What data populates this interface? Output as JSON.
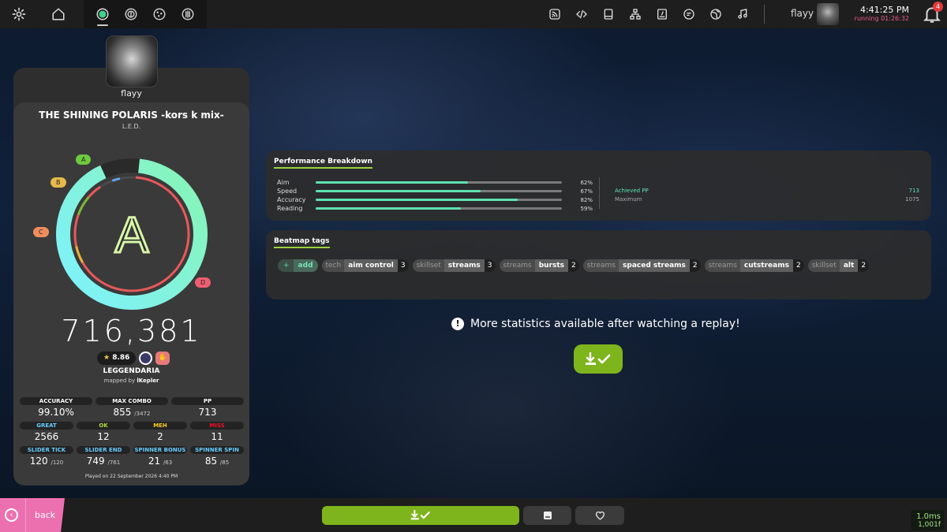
{
  "topbar": {
    "left_icons": [
      "gear-icon",
      "home-icon"
    ],
    "mode_icons": [
      "osu-mode-icon",
      "taiko-mode-icon",
      "catch-mode-icon",
      "mania-mode-icon"
    ],
    "active_mode": "osu-mode-icon",
    "right_icons": [
      "rss-icon",
      "code-icon",
      "book-icon",
      "sitemap-icon",
      "beatmap-listing-icon",
      "chat-icon",
      "globe-icon",
      "music-icon"
    ],
    "username": "flayy",
    "time": "4:41:25 PM",
    "running": "running 01:26:32",
    "notification_count": "4"
  },
  "score_panel": {
    "player_name": "flayy",
    "song_title": "THE SHINING POLARIS -kors k mix-",
    "artist": "L.E.D.",
    "rank": "A",
    "rank_markers": [
      "A",
      "B",
      "C",
      "D"
    ],
    "score": "716,381",
    "star_rating": "8.86",
    "difficulty": "LEGGENDARIA",
    "mapped_by_prefix": "mapped by",
    "mapper": "lKepler",
    "stats_rows": [
      [
        {
          "label": "ACCURACY",
          "value": "99.10%",
          "sub": "",
          "color": "#ffffff"
        },
        {
          "label": "MAX COMBO",
          "value": "855",
          "sub": "/3472",
          "color": "#ffffff"
        },
        {
          "label": "PP",
          "value": "713",
          "sub": "",
          "color": "#ffffff"
        }
      ],
      [
        {
          "label": "GREAT",
          "value": "2566",
          "sub": "",
          "color": "#66ccff"
        },
        {
          "label": "OK",
          "value": "12",
          "sub": "",
          "color": "#b3d944"
        },
        {
          "label": "MEH",
          "value": "2",
          "sub": "",
          "color": "#ffcc22"
        },
        {
          "label": "MISS",
          "value": "11",
          "sub": "",
          "color": "#ed1121"
        }
      ],
      [
        {
          "label": "SLIDER TICK",
          "value": "120",
          "sub": "/120",
          "color": "#66ccff"
        },
        {
          "label": "SLIDER END",
          "value": "749",
          "sub": "/761",
          "color": "#66ccff"
        },
        {
          "label": "SPINNER BONUS",
          "value": "21",
          "sub": "/63",
          "color": "#66ccff"
        },
        {
          "label": "SPINNER SPIN",
          "value": "85",
          "sub": "/85",
          "color": "#66ccff"
        }
      ]
    ],
    "played_on": "Played on 22 September 2026 4:40 PM"
  },
  "performance": {
    "title": "Performance Breakdown",
    "rows": [
      {
        "label": "Aim",
        "pct_text": "62%",
        "value": 0.62
      },
      {
        "label": "Speed",
        "pct_text": "67%",
        "value": 0.67
      },
      {
        "label": "Accuracy",
        "pct_text": "82%",
        "value": 0.82
      },
      {
        "label": "Reading",
        "pct_text": "59%",
        "value": 0.59
      }
    ],
    "achieved_label": "Achieved PP",
    "achieved_value": "713",
    "maximum_label": "Maximum",
    "maximum_value": "1075"
  },
  "tags": {
    "title": "Beatmap tags",
    "add_plus": "+",
    "add_label": "add",
    "items": [
      {
        "category": "tech",
        "name": "aim control",
        "count": "3"
      },
      {
        "category": "skillset",
        "name": "streams",
        "count": "3"
      },
      {
        "category": "streams",
        "name": "bursts",
        "count": "2"
      },
      {
        "category": "streams",
        "name": "spaced streams",
        "count": "2"
      },
      {
        "category": "streams",
        "name": "cutstreams",
        "count": "2"
      },
      {
        "category": "skillset",
        "name": "alt",
        "count": "2"
      }
    ]
  },
  "replay_notice": {
    "text": "More statistics available after watching a replay!",
    "icon": "!"
  },
  "bottombar": {
    "back_label": "back",
    "buttons": [
      "download-button",
      "beatmap-info-button",
      "favourite-button"
    ]
  },
  "perf_overlay": {
    "ms": "1.0ms",
    "fps": "1,001f"
  },
  "colors": {
    "accent_green": "#7eb51c",
    "back_pink": "#ec70b0",
    "perf_bar": "#5fe2b0",
    "rank_ring_green": "#88f5b4",
    "rank_ring_cyan": "#7ef1ff"
  }
}
